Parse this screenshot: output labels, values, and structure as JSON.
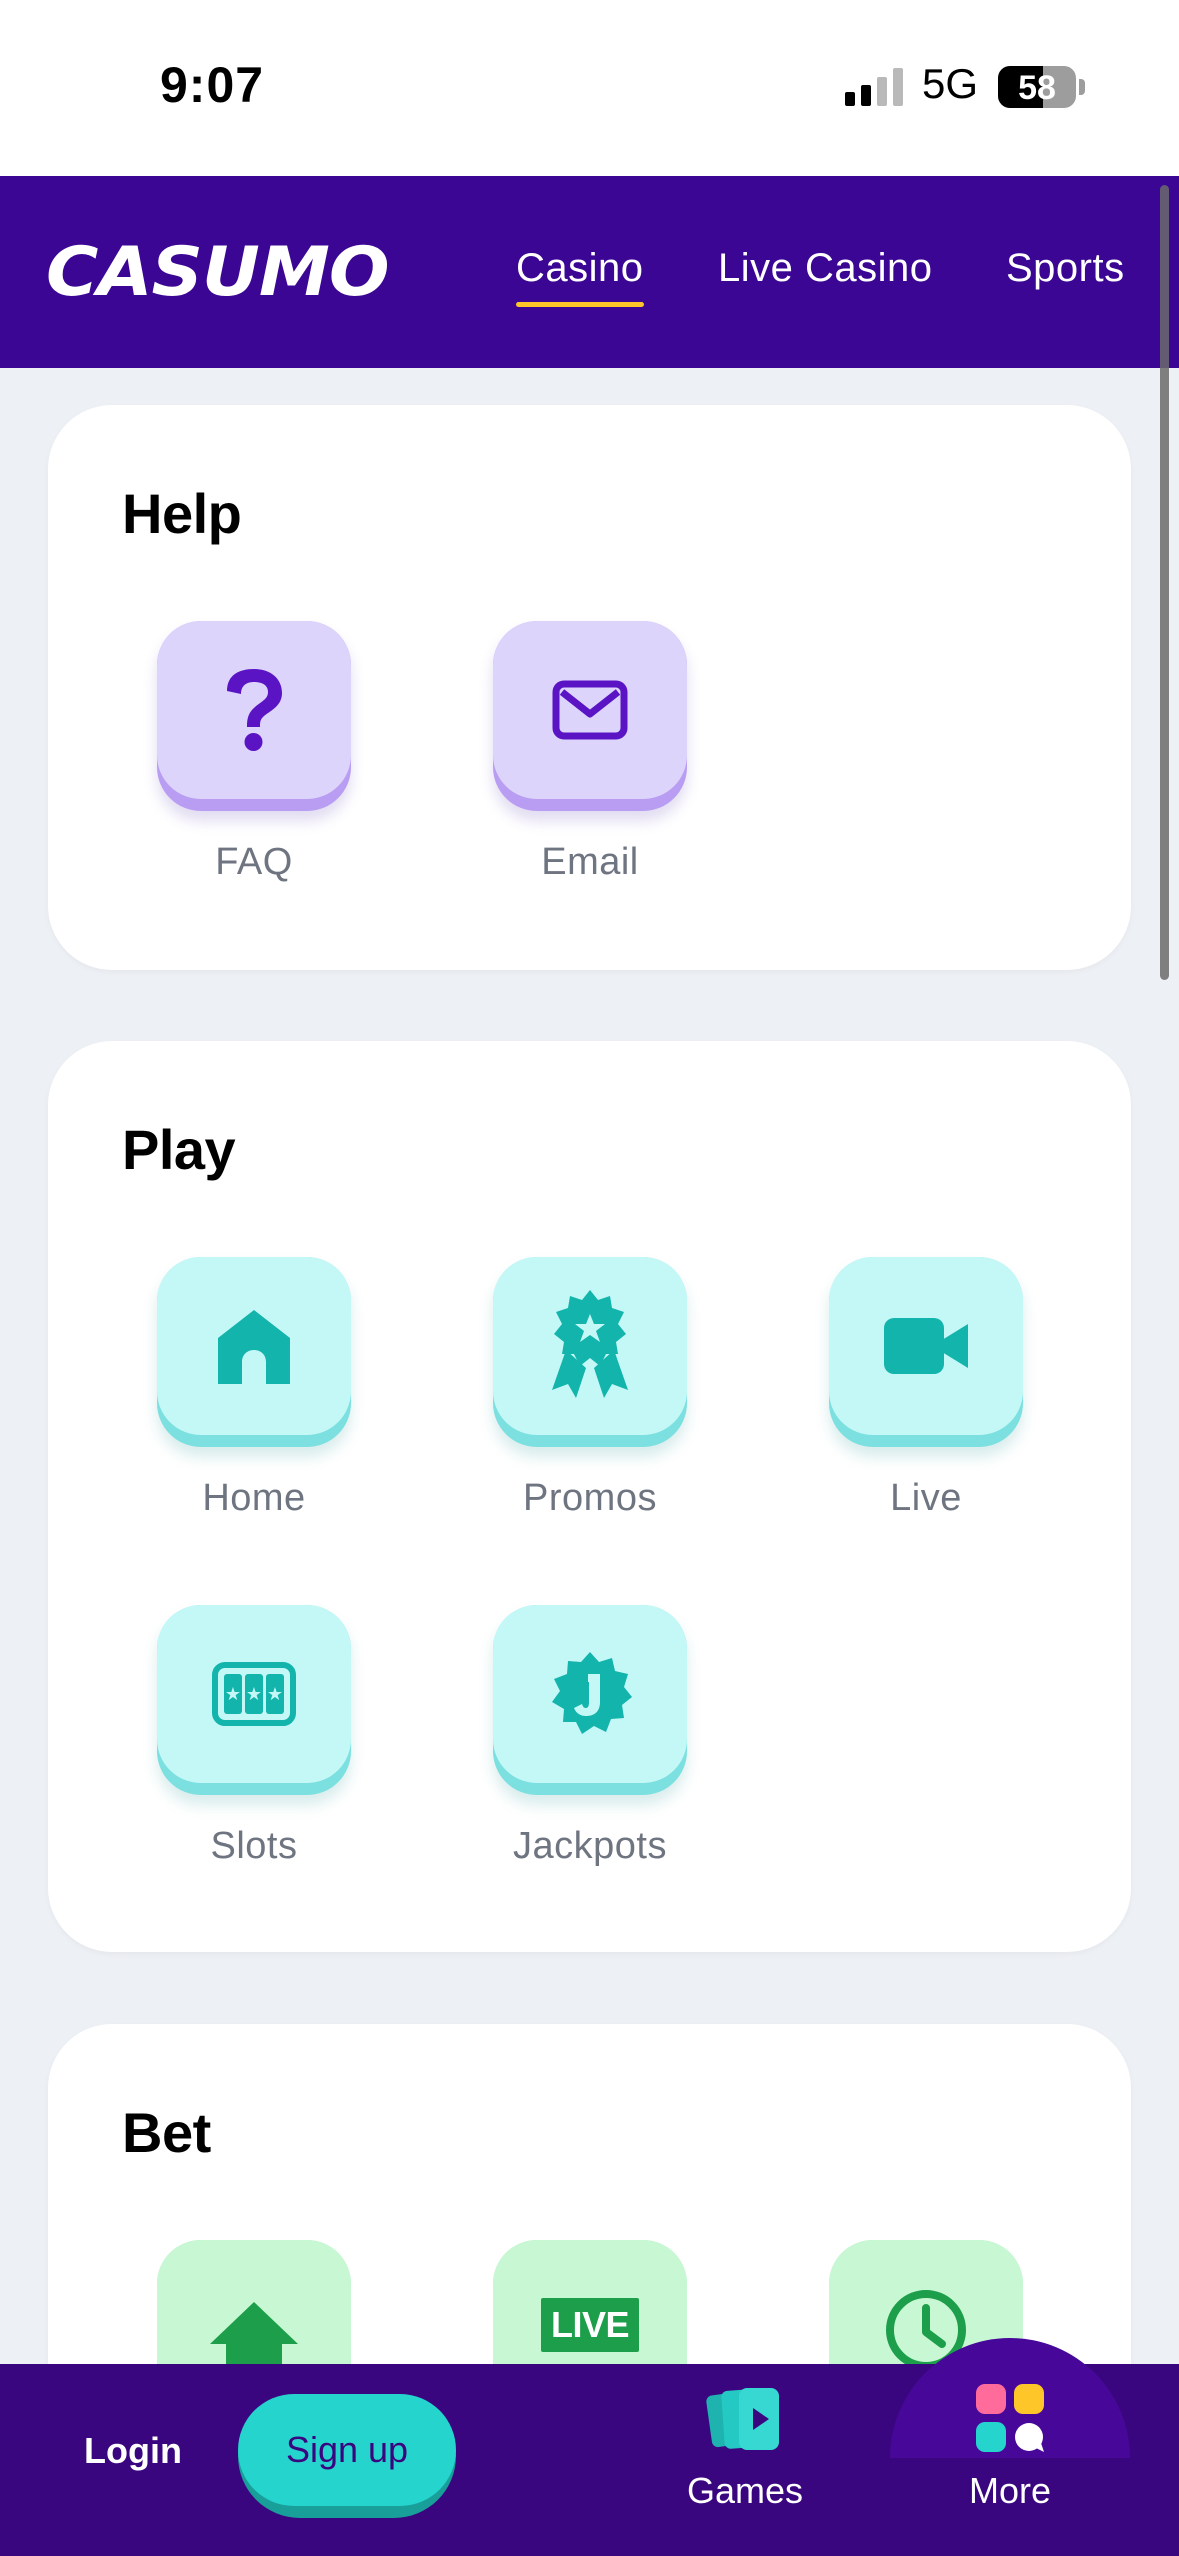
{
  "status_bar": {
    "time": "9:07",
    "network": "5G",
    "battery": "58",
    "battery_level": 0.58
  },
  "header": {
    "logo": "CASUMO",
    "tabs": [
      {
        "label": "Casino",
        "active": true
      },
      {
        "label": "Live Casino",
        "active": false
      },
      {
        "label": "Sports",
        "active": false
      }
    ]
  },
  "sections": {
    "help": {
      "title": "Help",
      "items": [
        {
          "label": "FAQ",
          "icon": "question-icon"
        },
        {
          "label": "Email",
          "icon": "envelope-icon"
        }
      ]
    },
    "play": {
      "title": "Play",
      "items": [
        {
          "label": "Home",
          "icon": "home-icon"
        },
        {
          "label": "Promos",
          "icon": "rosette-badge-icon"
        },
        {
          "label": "Live",
          "icon": "video-camera-icon"
        },
        {
          "label": "Slots",
          "icon": "slot-machine-icon"
        },
        {
          "label": "Jackpots",
          "icon": "jackpot-badge-icon"
        }
      ]
    },
    "bet": {
      "title": "Bet",
      "items": [
        {
          "icon": "sports-home-icon"
        },
        {
          "icon": "live-badge-icon",
          "badge_text": "LIVE"
        },
        {
          "icon": "clock-icon"
        }
      ]
    }
  },
  "bottom_nav": {
    "login": "Login",
    "signup": "Sign up",
    "games": "Games",
    "more": "More"
  },
  "colors": {
    "brand_purple": "#3b0693",
    "accent_yellow": "#ffc629",
    "teal": "#25d4cd",
    "help_icon": "#5a14c4",
    "play_icon": "#12b4ab",
    "bet_icon": "#1d9e4a"
  }
}
